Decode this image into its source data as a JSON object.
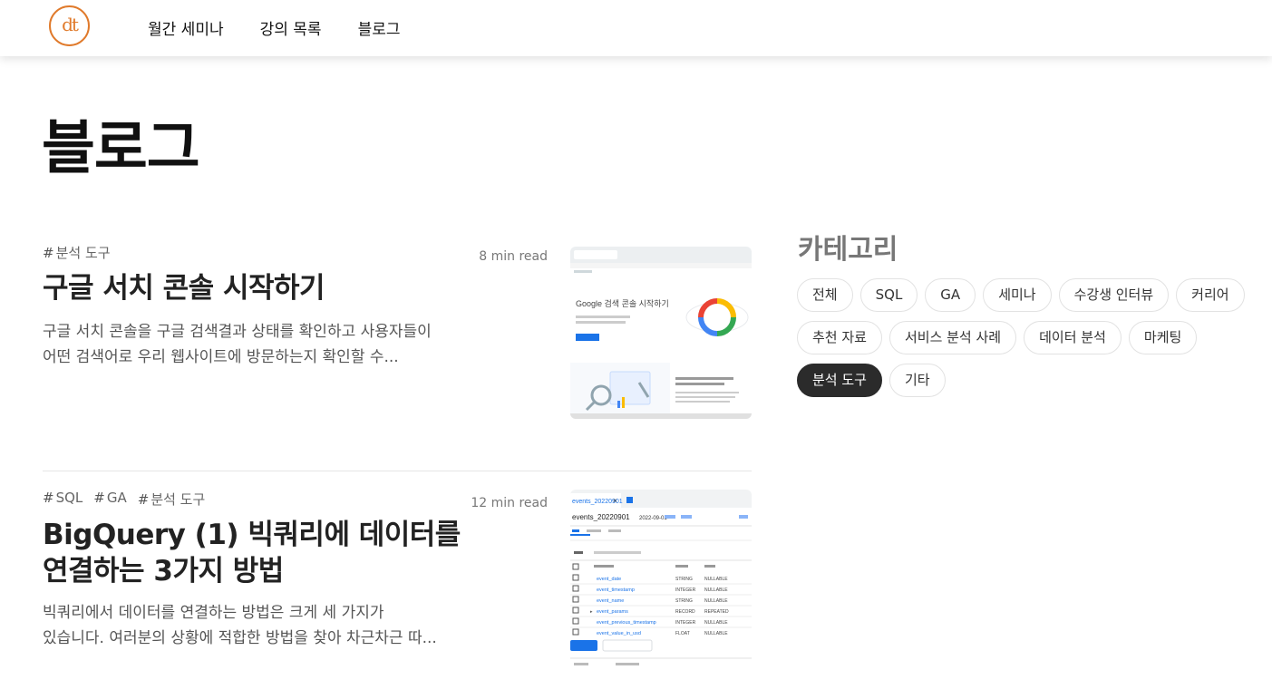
{
  "header": {
    "logo_text": "dt",
    "nav": [
      "월간 세미나",
      "강의 목록",
      "블로그"
    ]
  },
  "page": {
    "title": "블로그"
  },
  "posts": [
    {
      "tags": [
        "분석 도구"
      ],
      "read_time": "8 min read",
      "title_lines": [
        "구글 서치 콘솔 시작하기"
      ],
      "excerpt_lines": [
        "구글 서치 콘솔을 구글 검색결과 상태를 확인하고 사용자들이",
        "어떤 검색어로 우리 웹사이트에 방문하는지 확인할 수..."
      ],
      "thumbnail": {
        "heading": "Google 검색 콘솔 시작하기"
      }
    },
    {
      "tags": [
        "SQL",
        "GA",
        "분석 도구"
      ],
      "read_time": "12 min read",
      "title_lines": [
        "BigQuery (1) 빅쿼리에 데이터를",
        "연결하는 3가지 방법"
      ],
      "excerpt_lines": [
        "빅쿼리에서 데이터를 연결하는 방법은 크게 세 가지가",
        "있습니다. 여러분의 상황에 적합한 방법을 찾아 차근차근 따..."
      ],
      "thumbnail": {
        "tab_label": "events_20220901",
        "table_name": "events_20220901",
        "date": "2022-09-01",
        "fields": [
          {
            "name": "event_date",
            "type": "STRING",
            "mode": "NULLABLE"
          },
          {
            "name": "event_timestamp",
            "type": "INTEGER",
            "mode": "NULLABLE"
          },
          {
            "name": "event_name",
            "type": "STRING",
            "mode": "NULLABLE"
          },
          {
            "name": "event_params",
            "type": "RECORD",
            "mode": "REPEATED"
          },
          {
            "name": "event_previous_timestamp",
            "type": "INTEGER",
            "mode": "NULLABLE"
          },
          {
            "name": "event_value_in_usd",
            "type": "FLOAT",
            "mode": "NULLABLE"
          }
        ]
      }
    }
  ],
  "sidebar": {
    "title": "카테고리",
    "categories": [
      {
        "label": "전체",
        "active": false
      },
      {
        "label": "SQL",
        "active": false
      },
      {
        "label": "GA",
        "active": false
      },
      {
        "label": "세미나",
        "active": false
      },
      {
        "label": "수강생 인터뷰",
        "active": false
      },
      {
        "label": "커리어",
        "active": false
      },
      {
        "label": "추천 자료",
        "active": false
      },
      {
        "label": "서비스 분석 사례",
        "active": false
      },
      {
        "label": "데이터 분석",
        "active": false
      },
      {
        "label": "마케팅",
        "active": false
      },
      {
        "label": "분석 도구",
        "active": true
      },
      {
        "label": "기타",
        "active": false
      }
    ]
  },
  "colors": {
    "brand": "#e07a2b",
    "active_chip": "#2b2b2b",
    "google_blue": "#1a73e8"
  }
}
